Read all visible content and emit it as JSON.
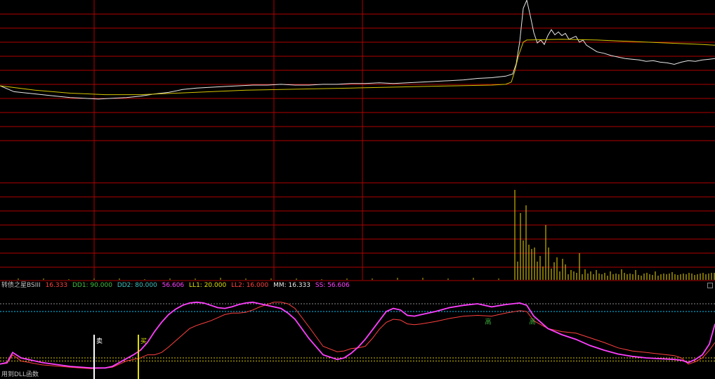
{
  "chart_data": [
    {
      "type": "line",
      "panel": "price",
      "series": [
        {
          "color": "#e8e8e8",
          "x": [
            0,
            20,
            40,
            60,
            80,
            100,
            120,
            140,
            160,
            180,
            200,
            220,
            240,
            260,
            280,
            300,
            320,
            340,
            360,
            380,
            400,
            420,
            440,
            460,
            480,
            500,
            520,
            540,
            560,
            580,
            600,
            620,
            640,
            660,
            680,
            700,
            720,
            730,
            735,
            740,
            745,
            750,
            755,
            760,
            765,
            770,
            775,
            780,
            785,
            790,
            795,
            800,
            805,
            810,
            815,
            820,
            825,
            830,
            835,
            840,
            850,
            860,
            870,
            880,
            890,
            900,
            910,
            920,
            930,
            940,
            950,
            960,
            970,
            980,
            990,
            1000,
            1010,
            1018
          ],
          "y": [
            0.0,
            -0.8,
            -1.0,
            -1.2,
            -1.4,
            -1.6,
            -1.7,
            -1.8,
            -1.7,
            -1.6,
            -1.4,
            -1.1,
            -0.9,
            -0.5,
            -0.3,
            -0.2,
            -0.1,
            0.0,
            0.1,
            0.1,
            0.2,
            0.1,
            0.1,
            0.2,
            0.2,
            0.3,
            0.3,
            0.4,
            0.3,
            0.4,
            0.5,
            0.6,
            0.7,
            0.8,
            1.0,
            1.1,
            1.3,
            1.6,
            3.0,
            6.0,
            10.5,
            11.6,
            9.5,
            7.2,
            5.8,
            6.2,
            5.6,
            6.8,
            7.6,
            6.9,
            7.3,
            6.8,
            7.1,
            6.3,
            6.5,
            6.7,
            5.9,
            6.2,
            5.5,
            5.2,
            4.6,
            4.4,
            4.1,
            3.9,
            3.7,
            3.6,
            3.5,
            3.3,
            3.4,
            3.2,
            3.1,
            2.9,
            3.2,
            3.4,
            3.3,
            3.5,
            3.6,
            3.7
          ]
        },
        {
          "color": "#d4c400",
          "x": [
            0,
            50,
            100,
            150,
            200,
            250,
            300,
            350,
            400,
            450,
            500,
            550,
            600,
            650,
            700,
            720,
            728,
            733,
            738,
            745,
            750,
            800,
            850,
            900,
            950,
            1000,
            1018
          ],
          "y": [
            0.0,
            -0.6,
            -1.0,
            -1.2,
            -1.2,
            -1.0,
            -0.8,
            -0.6,
            -0.5,
            -0.4,
            -0.3,
            -0.2,
            -0.1,
            0.0,
            0.1,
            0.2,
            0.5,
            2.0,
            4.0,
            5.9,
            6.2,
            6.3,
            6.2,
            6.0,
            5.8,
            5.6,
            5.5
          ]
        }
      ]
    },
    {
      "type": "bar",
      "panel": "volume",
      "x": [
        733,
        737,
        741,
        745,
        749,
        753,
        757,
        761,
        765,
        769,
        773,
        777,
        781,
        785,
        789,
        793,
        797,
        801,
        805,
        809,
        813,
        817,
        821,
        825,
        829,
        833,
        837,
        841,
        845,
        849,
        853,
        857,
        861,
        865,
        869,
        873,
        877,
        881,
        885,
        889,
        893,
        897,
        901,
        905,
        909,
        913,
        917,
        921,
        925,
        929,
        933,
        937,
        941,
        945,
        949,
        953,
        957,
        961,
        965,
        969,
        973,
        977,
        981,
        985,
        989,
        993,
        997,
        1001,
        1005,
        1009,
        1013,
        1017
      ],
      "values": [
        128,
        26,
        95,
        56,
        106,
        50,
        44,
        46,
        26,
        34,
        19,
        78,
        46,
        16,
        25,
        32,
        12,
        30,
        22,
        8,
        14,
        12,
        10,
        38,
        8,
        15,
        9,
        12,
        8,
        14,
        9,
        8,
        10,
        6,
        12,
        8,
        9,
        8,
        15,
        10,
        8,
        9,
        8,
        14,
        7,
        6,
        9,
        10,
        8,
        7,
        12,
        6,
        8,
        9,
        8,
        9,
        11,
        8,
        7,
        8,
        9,
        8,
        10,
        9,
        7,
        8,
        9,
        10,
        8,
        9,
        10,
        10
      ],
      "pre_x": [
        26,
        62,
        98,
        134,
        170,
        206,
        242,
        278,
        314,
        350,
        386,
        422,
        458,
        494,
        530,
        566,
        602,
        638,
        674,
        710
      ],
      "pre_values": [
        2,
        2,
        1,
        2,
        2,
        1,
        2,
        2,
        3,
        2,
        2,
        2,
        1,
        2,
        2,
        3,
        3,
        2,
        3,
        2
      ]
    },
    {
      "type": "line",
      "panel": "indicator",
      "title": "转债之星BSIII",
      "legend": [
        {
          "label": "16.333",
          "color": "#ff4040"
        },
        {
          "label": "DD1: 90.000",
          "color": "#40c040"
        },
        {
          "label": "DD2: 80.000",
          "color": "#40c0c0"
        },
        {
          "label": "56.606",
          "color": "#ff40ff"
        },
        {
          "label": "LL1: 20.000",
          "color": "#e0e000"
        },
        {
          "label": "LL2: 16.000",
          "color": "#ff4040"
        },
        {
          "label": "MM: 16.333",
          "color": "#e8e8e8"
        },
        {
          "label": "SS: 56.606",
          "color": "#ff40ff"
        }
      ],
      "hlines": [
        {
          "value": 90,
          "color": "#8a8a8a"
        },
        {
          "value": 80,
          "color": "#00c8ff"
        },
        {
          "value": 20,
          "color": "#d4c400"
        },
        {
          "value": 16,
          "color": "#d4c400"
        }
      ],
      "ylim": [
        0,
        100
      ],
      "series": [
        {
          "name": "MM",
          "color": "#ff4040",
          "x": [
            0,
            10,
            18,
            30,
            60,
            100,
            130,
            150,
            160,
            170,
            180,
            190,
            200,
            210,
            220,
            230,
            240,
            250,
            260,
            270,
            280,
            290,
            300,
            310,
            320,
            330,
            340,
            350,
            360,
            370,
            380,
            390,
            400,
            410,
            420,
            440,
            460,
            480,
            490,
            500,
            510,
            520,
            530,
            540,
            550,
            560,
            570,
            580,
            590,
            600,
            620,
            640,
            660,
            680,
            700,
            720,
            740,
            750,
            760,
            780,
            800,
            820,
            840,
            860,
            880,
            900,
            920,
            940,
            960,
            970,
            980,
            990,
            1000,
            1010,
            1018
          ],
          "y": [
            12,
            13,
            24,
            16,
            11,
            8,
            6,
            7,
            8,
            12,
            16,
            18,
            20,
            24,
            24,
            27,
            34,
            42,
            50,
            58,
            62,
            65,
            68,
            72,
            76,
            78,
            78,
            79,
            82,
            86,
            89,
            92,
            92,
            90,
            84,
            60,
            35,
            28,
            29,
            32,
            33,
            35,
            45,
            57,
            66,
            70,
            69,
            64,
            63,
            64,
            67,
            71,
            74,
            75,
            74,
            78,
            81,
            80,
            68,
            58,
            54,
            52,
            46,
            40,
            33,
            29,
            27,
            25,
            23,
            20,
            12,
            15,
            20,
            30,
            40
          ]
        },
        {
          "name": "SS",
          "color": "#ff40ff",
          "x": [
            0,
            10,
            18,
            30,
            60,
            100,
            130,
            150,
            160,
            170,
            180,
            190,
            200,
            210,
            220,
            230,
            240,
            250,
            260,
            270,
            280,
            290,
            300,
            310,
            320,
            330,
            340,
            350,
            360,
            370,
            380,
            390,
            400,
            410,
            420,
            440,
            460,
            480,
            490,
            500,
            510,
            520,
            530,
            540,
            550,
            560,
            570,
            580,
            590,
            600,
            620,
            640,
            660,
            680,
            700,
            720,
            740,
            750,
            760,
            780,
            800,
            820,
            840,
            860,
            880,
            900,
            920,
            940,
            960,
            970,
            980,
            990,
            1000,
            1010,
            1018
          ],
          "y": [
            12,
            14,
            27,
            20,
            14,
            9,
            7,
            7,
            9,
            14,
            19,
            24,
            30,
            40,
            54,
            66,
            76,
            83,
            88,
            91,
            92,
            91,
            88,
            85,
            84,
            86,
            89,
            91,
            92,
            90,
            88,
            86,
            84,
            78,
            70,
            45,
            24,
            18,
            20,
            26,
            34,
            44,
            56,
            68,
            80,
            84,
            82,
            75,
            74,
            76,
            80,
            85,
            88,
            90,
            86,
            89,
            91,
            88,
            74,
            58,
            50,
            44,
            36,
            30,
            25,
            22,
            20,
            19,
            18,
            17,
            14,
            18,
            24,
            38,
            64
          ]
        }
      ],
      "markers": [
        {
          "label": "卖",
          "x": 134,
          "color": "#ffffff"
        },
        {
          "label": "买",
          "x": 197,
          "color": "#e0e000"
        }
      ],
      "annotations": [
        {
          "label": "高",
          "x": 695,
          "y": 64,
          "color": "#40c040"
        },
        {
          "label": "高",
          "x": 758,
          "y": 64,
          "color": "#40c040"
        }
      ]
    }
  ],
  "footer": "用到DLL函数"
}
